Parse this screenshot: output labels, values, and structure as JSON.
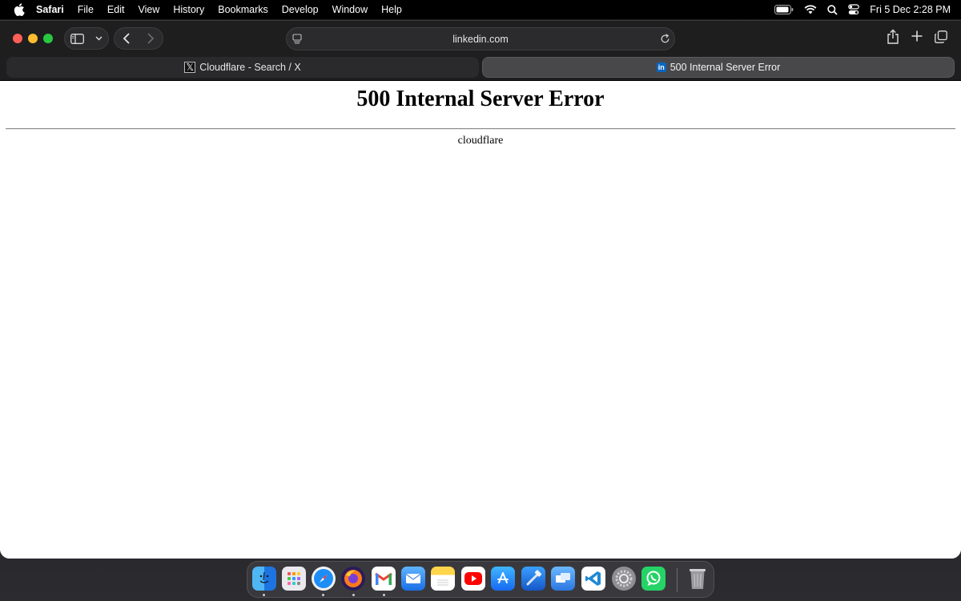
{
  "menubar": {
    "app_name": "Safari",
    "items": [
      "File",
      "Edit",
      "View",
      "History",
      "Bookmarks",
      "Develop",
      "Window",
      "Help"
    ],
    "clock": "Fri 5 Dec  2:28 PM"
  },
  "toolbar": {
    "url": "linkedin.com"
  },
  "tabs": [
    {
      "title": "Cloudflare - Search / X",
      "favicon": "x-logo-icon"
    },
    {
      "title": "500 Internal Server Error",
      "favicon": "linkedin-icon",
      "favicon_text": "in"
    }
  ],
  "page": {
    "heading": "500 Internal Server Error",
    "server": "cloudflare"
  },
  "dock": {
    "apps": [
      "Finder",
      "Launchpad",
      "Safari",
      "Firefox",
      "Gmail",
      "Mail",
      "Notes",
      "YouTube",
      "App Store",
      "Xcode",
      "Remote Desktop",
      "Visual Studio Code",
      "System Settings",
      "WhatsApp",
      "Trash"
    ]
  },
  "colors": {
    "close": "#ff5f57",
    "minimize": "#febc2e",
    "zoom": "#28c840",
    "linkedin": "#0a66c2"
  }
}
